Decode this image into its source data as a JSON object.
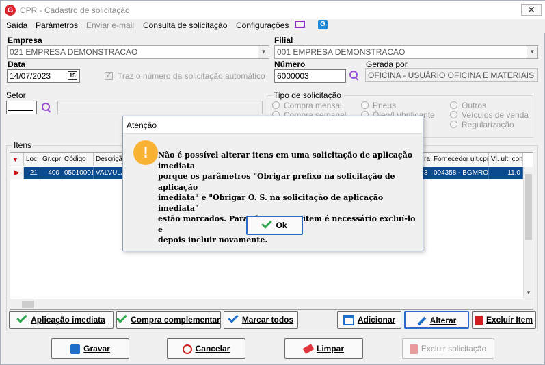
{
  "window": {
    "title": "CPR - Cadastro de solicitação",
    "app_icon": "app-logo-icon",
    "close": "close-icon"
  },
  "menu": {
    "items": [
      "Saída",
      "Parâmetros",
      "Enviar e-mail",
      "Consulta de solicitação",
      "Configurações"
    ]
  },
  "form": {
    "empresa_label": "Empresa",
    "empresa_value": "021 EMPRESA DEMONSTRACAO",
    "filial_label": "Filial",
    "filial_value": "001 EMPRESA DEMONSTRACAO",
    "data_label": "Data",
    "data_value": "14/07/2023",
    "calendar_icon": "15",
    "auto_number_label": "Traz o número da solicitação automático",
    "numero_label": "Número",
    "numero_value": "6000003",
    "gerada_por_label": "Gerada por",
    "gerada_por_value": "OFICINA - USUÁRIO OFICINA E MATERIAIS",
    "setor_label": "Setor",
    "setor_value": "",
    "tipo_label": "Tipo de solicitação",
    "tipo_options": [
      "Compra mensal",
      "Compra semanal",
      "Pneus",
      "Óleo/Lubrificante",
      "Outros",
      "Veículos de venda",
      "Regularização"
    ]
  },
  "itens": {
    "label": "Itens",
    "columns_left": [
      "Loc",
      "Gr.cpr",
      "Código",
      "Descriçã"
    ],
    "columns_right": [
      "ra",
      "Fornecedor ult.cpr",
      "Vl. ult. com"
    ],
    "row": {
      "loc": "21",
      "grcpr": "400",
      "codigo": "05010001",
      "descricao": "VALVULA",
      "ra": "3",
      "fornecedor": "004358 - BGMRO...",
      "vl": "11,0"
    }
  },
  "item_buttons": {
    "aplicacao": "Aplicação imediata",
    "compra": "Compra complementar",
    "marcar": "Marcar todos",
    "adicionar": "Adicionar",
    "alterar": "Alterar",
    "excluir_item": "Excluir Item"
  },
  "bottom_buttons": {
    "gravar": "Gravar",
    "cancelar": "Cancelar",
    "limpar": "Limpar",
    "excluir_solicitacao": "Excluir solicitação"
  },
  "dialog": {
    "title": "Atenção",
    "lines": [
      "Não é possível alterar itens em uma solicitação de aplicação imediata",
      "porque os parâmetros \"Obrigar prefixo na solicitação de aplicação",
      "imediata\" e \"Obrigar O. S. na solicitação de aplicação imediata\"",
      "estão marcados. Para alterar esse item é necessário excluí-lo e",
      "depois incluir novamente."
    ],
    "ok": "Ok"
  },
  "colors": {
    "accent": "#0a4a8f",
    "warning": "#f9b233",
    "brand": "#d9262c"
  }
}
